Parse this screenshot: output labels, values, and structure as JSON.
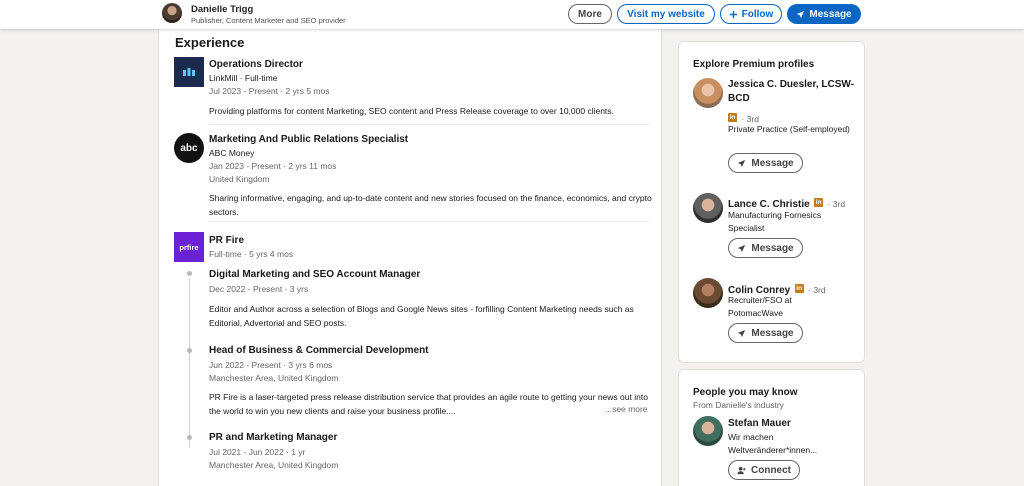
{
  "header": {
    "name": "Danielle Trigg",
    "headline": "Publisher, Content Marketer and SEO provider",
    "more_label": "More",
    "website_label": "Visit my website",
    "follow_label": "Follow",
    "message_label": "Message",
    "accent": "#0a66c2"
  },
  "experience": {
    "title": "Experience",
    "jobs": [
      {
        "role": "Operations Director",
        "company": "LinkMill · Full-time",
        "dates": "Jul 2023 - Present · 2 yrs 5 mos",
        "description": "Providing platforms for content Marketing, SEO content and Press Release coverage to over 10,000 clients.",
        "logo_icon": "linkmill-logo"
      },
      {
        "role": "Marketing And Public Relations Specialist",
        "company": "ABC Money",
        "dates": "Jan 2023 - Present · 2 yrs 11 mos",
        "location": "United Kingdom",
        "description": "Sharing informative, engaging, and up-to-date content and new stories focused on the finance, economics, and crypto sectors.",
        "logo_text": "abc"
      },
      {
        "company": "PR Fire",
        "duration": "Full-time · 5 yrs 4 mos",
        "logo_text": "prfire",
        "positions": [
          {
            "role": "Digital Marketing and SEO Account Manager",
            "dates": "Dec 2022 - Present · 3 yrs",
            "description": "Editor and Author across a selection of Blogs and Google News sites - forfilling Content Marketing needs such as Editorial, Advertorial and SEO posts."
          },
          {
            "role": "Head of Business & Commercial Development",
            "dates": "Jun 2022 - Present · 3 yrs 6 mos",
            "location": "Manchester Area, United Kingdom",
            "description": "PR Fire is a laser-targeted press release distribution service that provides an agile route to getting your news out into the world to win you new clients and raise your business profile....",
            "see_more": "...see more"
          },
          {
            "role": "PR and Marketing Manager",
            "dates": "Jul 2021 - Jun 2022 · 1 yr",
            "location": "Manchester Area, United Kingdom"
          }
        ]
      }
    ]
  },
  "premium": {
    "title": "Explore Premium profiles",
    "message_label": "Message",
    "profiles": [
      {
        "name": "Jessica C. Duesler, LCSW-BCD",
        "degree": "· 3rd",
        "badge": "in",
        "description": "Private Practice (Self-employed)"
      },
      {
        "name": "Lance C. Christie",
        "degree": "· 3rd",
        "badge": "in",
        "description": "Manufacturing Fornesics Specialist"
      },
      {
        "name": "Colin Conrey",
        "degree": "· 3rd",
        "badge": "in",
        "description": "Recruiter/FSO at PotomacWave"
      }
    ]
  },
  "people": {
    "title": "People you may know",
    "subtitle": "From Danielle's industry",
    "connect_label": "Connect",
    "profiles": [
      {
        "name": "Stefan Mauer",
        "description": "Wir machen Weltveränderer*innen..."
      }
    ]
  }
}
